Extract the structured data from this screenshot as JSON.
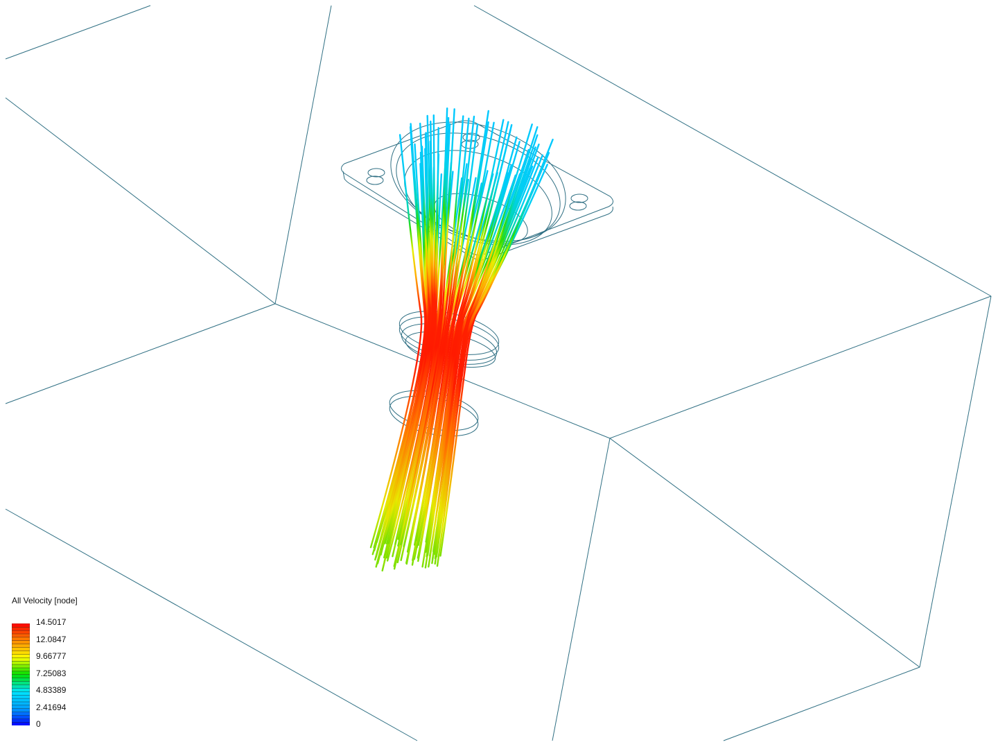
{
  "legend": {
    "title": "All Velocity [node]",
    "labels": [
      "14.5017",
      "12.0847",
      "9.66777",
      "7.25083",
      "4.83389",
      "2.41694",
      "0"
    ],
    "min": 0,
    "max": 14.5017,
    "colormap": [
      "#0000ff",
      "#00a0ff",
      "#00e5ff",
      "#00e000",
      "#ffff00",
      "#ff8800",
      "#ff0000"
    ]
  },
  "colors": {
    "wireframe": "#2f6f83",
    "background": "#ffffff"
  }
}
